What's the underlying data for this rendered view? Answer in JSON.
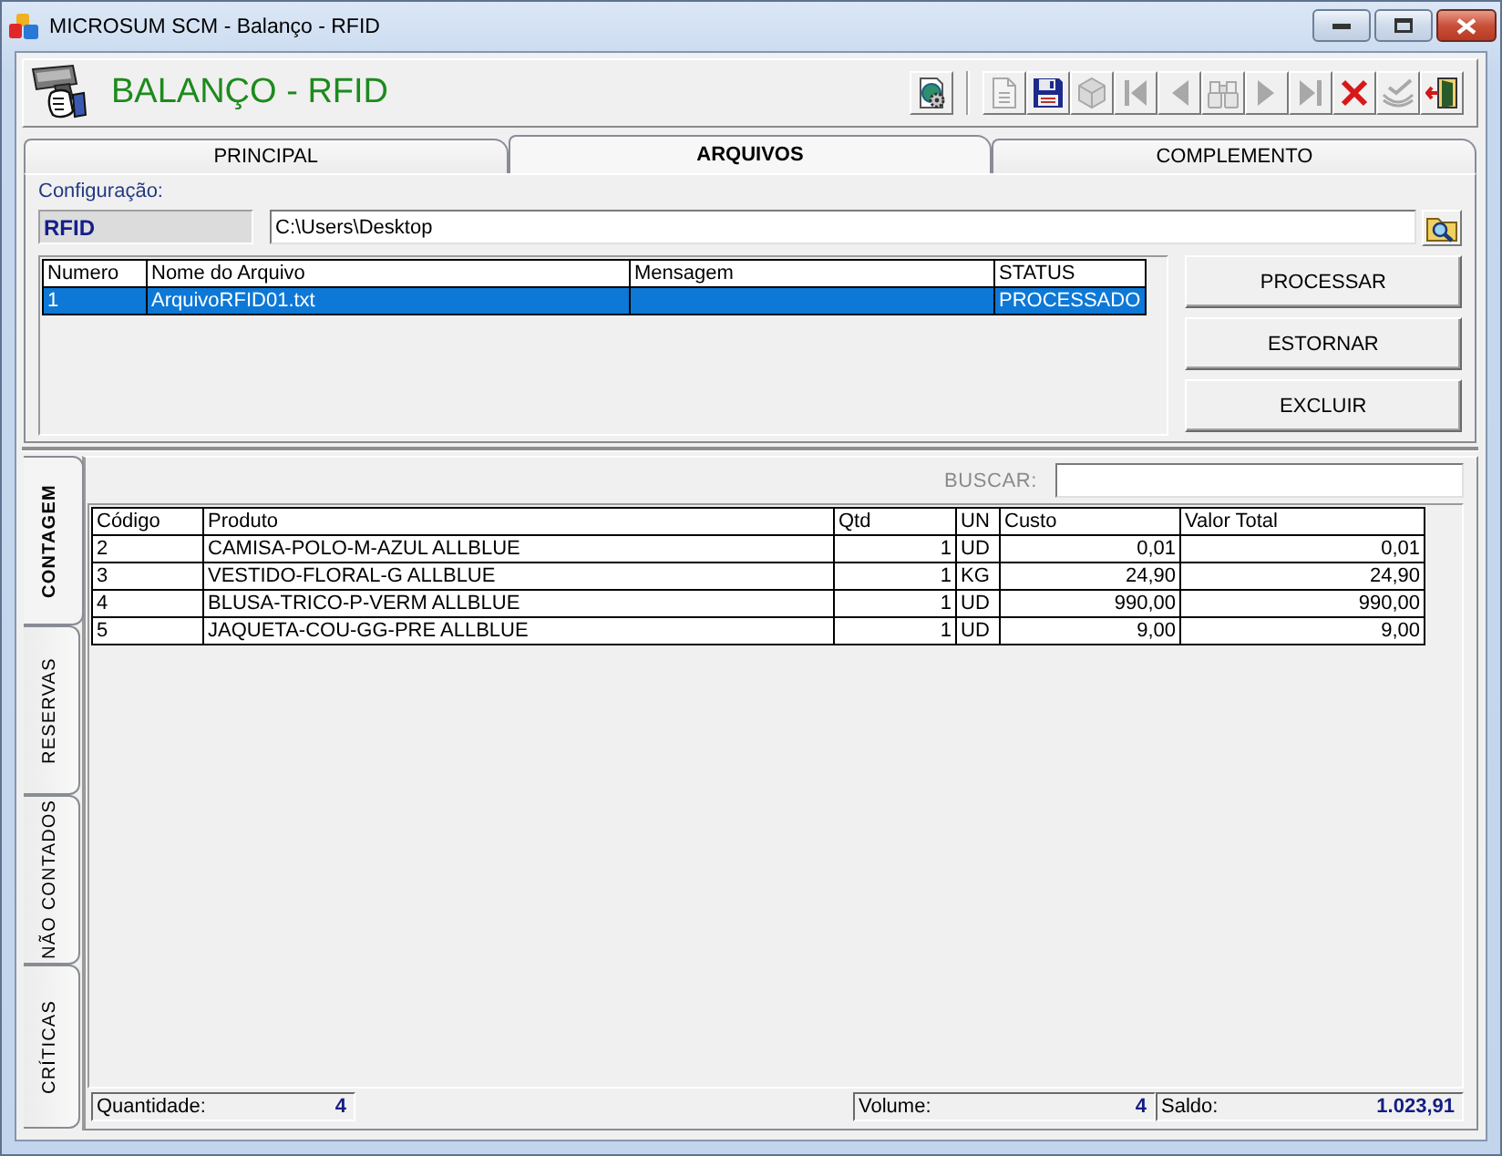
{
  "window": {
    "title": "MICROSUM SCM - Balanço - RFID"
  },
  "header": {
    "title": "BALANÇO - RFID"
  },
  "toolbar": [
    [
      {
        "kind": "settings",
        "disabled": false
      }
    ],
    [
      {
        "kind": "new",
        "disabled": true
      },
      {
        "kind": "save",
        "disabled": false
      },
      {
        "kind": "cancel",
        "disabled": true
      },
      {
        "kind": "first",
        "disabled": true
      },
      {
        "kind": "previous",
        "disabled": true
      },
      {
        "kind": "find",
        "disabled": true
      },
      {
        "kind": "next",
        "disabled": true
      },
      {
        "kind": "last",
        "disabled": true
      },
      {
        "kind": "delete",
        "disabled": false
      },
      {
        "kind": "confirm",
        "disabled": true
      },
      {
        "kind": "exit",
        "disabled": false
      }
    ]
  ],
  "tabs": [
    {
      "label": "PRINCIPAL",
      "selected": false
    },
    {
      "label": "ARQUIVOS",
      "selected": true
    },
    {
      "label": "COMPLEMENTO",
      "selected": false
    }
  ],
  "configuration": {
    "label": "Configuração:",
    "type": "RFID",
    "path": "C:\\Users\\Desktop"
  },
  "files_table": {
    "columns": [
      "Numero",
      "Nome do Arquivo",
      "Mensagem",
      "STATUS"
    ],
    "rows": [
      {
        "cells": [
          "1",
          "ArquivoRFID01.txt",
          null,
          "PROCESSADO"
        ],
        "selected": true
      }
    ]
  },
  "actions": [
    {
      "label": "PROCESSAR"
    },
    {
      "label": "ESTORNAR"
    },
    {
      "label": "EXCLUIR"
    }
  ],
  "side_tabs": [
    {
      "label": "CONTAGEM",
      "selected": true
    },
    {
      "label": "RESERVAS",
      "selected": false
    },
    {
      "label": "NÃO CONTADOS",
      "selected": false
    },
    {
      "label": "CRÍTICAS",
      "selected": false
    }
  ],
  "search": {
    "label": "BUSCAR:"
  },
  "items_table": {
    "columns": [
      "Código",
      "Produto",
      "Qtd",
      "UN",
      "Custo",
      "Valor Total"
    ],
    "rows": [
      [
        "2",
        "CAMISA-POLO-M-AZUL ALLBLUE",
        "1",
        "UD",
        "0,01",
        "0,01"
      ],
      [
        "3",
        "VESTIDO-FLORAL-G ALLBLUE",
        "1",
        "KG",
        "24,90",
        "24,90"
      ],
      [
        "4",
        "BLUSA-TRICO-P-VERM ALLBLUE",
        "1",
        "UD",
        "990,00",
        "990,00"
      ],
      [
        "5",
        "JAQUETA-COU-GG-PRE ALLBLUE",
        "1",
        "UD",
        "9,00",
        "9,00"
      ]
    ]
  },
  "totals": {
    "left": [
      {
        "label": "Quantidade:",
        "value": "4"
      }
    ],
    "right": [
      {
        "label": "Volume:",
        "value": "4"
      },
      {
        "label": "Saldo:",
        "value": "1.023,91"
      }
    ]
  }
}
